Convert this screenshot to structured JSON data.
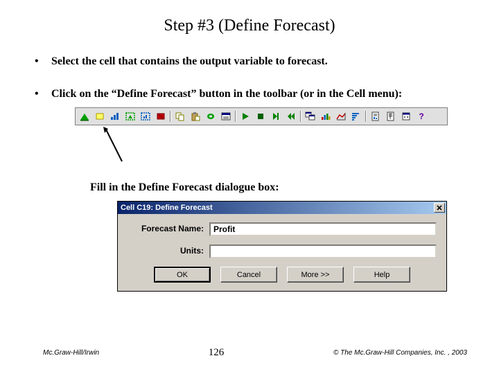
{
  "title": "Step #3 (Define Forecast)",
  "bullets": {
    "b1": "Select the cell that contains the output variable to forecast.",
    "b2": "Click on the “Define Forecast” button in the toolbar (or in the Cell menu):"
  },
  "subtext": "Fill in the Define Forecast dialogue box:",
  "toolbar": {
    "icons": [
      "define-assumption-icon",
      "define-decision-icon",
      "define-forecast-icon",
      "select-assumptions-icon",
      "select-forecasts-icon",
      "freeze-icon",
      "copy-data-icon",
      "paste-data-icon",
      "clear-data-icon",
      "cell-prefs-icon",
      "run-icon",
      "stop-icon",
      "single-step-icon",
      "reset-icon",
      "forecast-windows-icon",
      "overlay-chart-icon",
      "trend-chart-icon",
      "sensitivity-icon",
      "create-report-icon",
      "extract-data-icon",
      "run-prefs-icon",
      "help-icon"
    ]
  },
  "dialog": {
    "title": "Cell C19: Define Forecast",
    "fields": {
      "name_label": "Forecast Name:",
      "name_value": "Profit",
      "units_label": "Units:",
      "units_value": ""
    },
    "buttons": {
      "ok": "OK",
      "cancel": "Cancel",
      "more": "More >>",
      "help": "Help"
    }
  },
  "footer": {
    "left": "Mc.Graw-Hill/Irwin",
    "page": "126",
    "right": "© The Mc.Graw-Hill Companies, Inc. , 2003"
  }
}
